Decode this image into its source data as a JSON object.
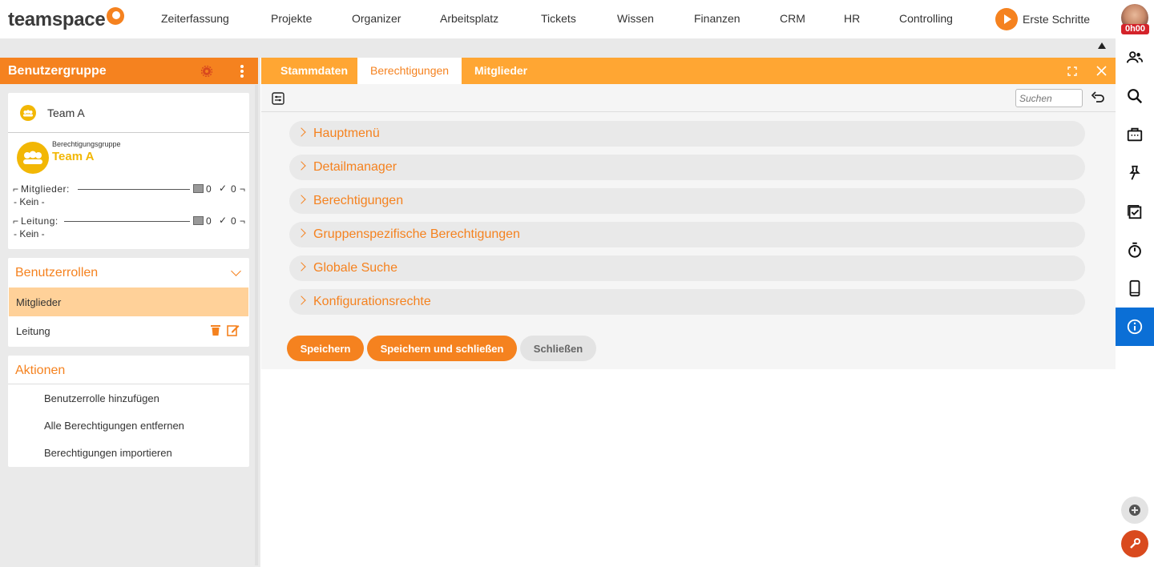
{
  "brand": {
    "name": "teamspace"
  },
  "nav": {
    "items": [
      "Zeiterfassung",
      "Projekte",
      "Organizer",
      "Arbeitsplatz",
      "Tickets",
      "Wissen",
      "Finanzen",
      "CRM",
      "HR",
      "Controlling"
    ],
    "start_label": "Erste Schritte",
    "time_badge": "0h00"
  },
  "left": {
    "header_title": "Benutzergruppe",
    "team_card_title": "Team A",
    "group_type": "Berechtigungsgruppe",
    "group_name": "Team A",
    "members_label": "Mitglieder:",
    "members_count_a": "0",
    "members_count_b": "0",
    "members_value": "- Kein -",
    "lead_label": "Leitung:",
    "lead_count_a": "0",
    "lead_count_b": "0",
    "lead_value": "- Kein -",
    "roles_title": "Benutzerrollen",
    "roles": [
      "Mitglieder",
      "Leitung"
    ],
    "actions_title": "Aktionen",
    "actions": [
      "Benutzerrolle hinzufügen",
      "Alle Berechtigungen entfernen",
      "Berechtigungen importieren"
    ]
  },
  "main": {
    "tabs": [
      "Stammdaten",
      "Berechtigungen",
      "Mitglieder"
    ],
    "active_tab": "Berechtigungen",
    "search_placeholder": "Suchen",
    "sections": [
      "Hauptmenü",
      "Detailmanager",
      "Berechtigungen",
      "Gruppenspezifische Berechtigungen",
      "Globale Suche",
      "Konfigurationsrechte"
    ],
    "buttons": {
      "save": "Speichern",
      "save_close": "Speichern und schließen",
      "close": "Schließen"
    }
  },
  "colors": {
    "accent": "#f5821f",
    "accent_light": "#ffa633",
    "selected_row": "#ffd199",
    "active_sidebar": "#0b6fd6",
    "group_icon": "#f2b705"
  },
  "sidebar_icons": [
    "users-icon",
    "search-icon",
    "briefcase-icon",
    "pin-icon",
    "calendar-check-icon",
    "stopwatch-icon",
    "phone-icon",
    "info-icon"
  ]
}
